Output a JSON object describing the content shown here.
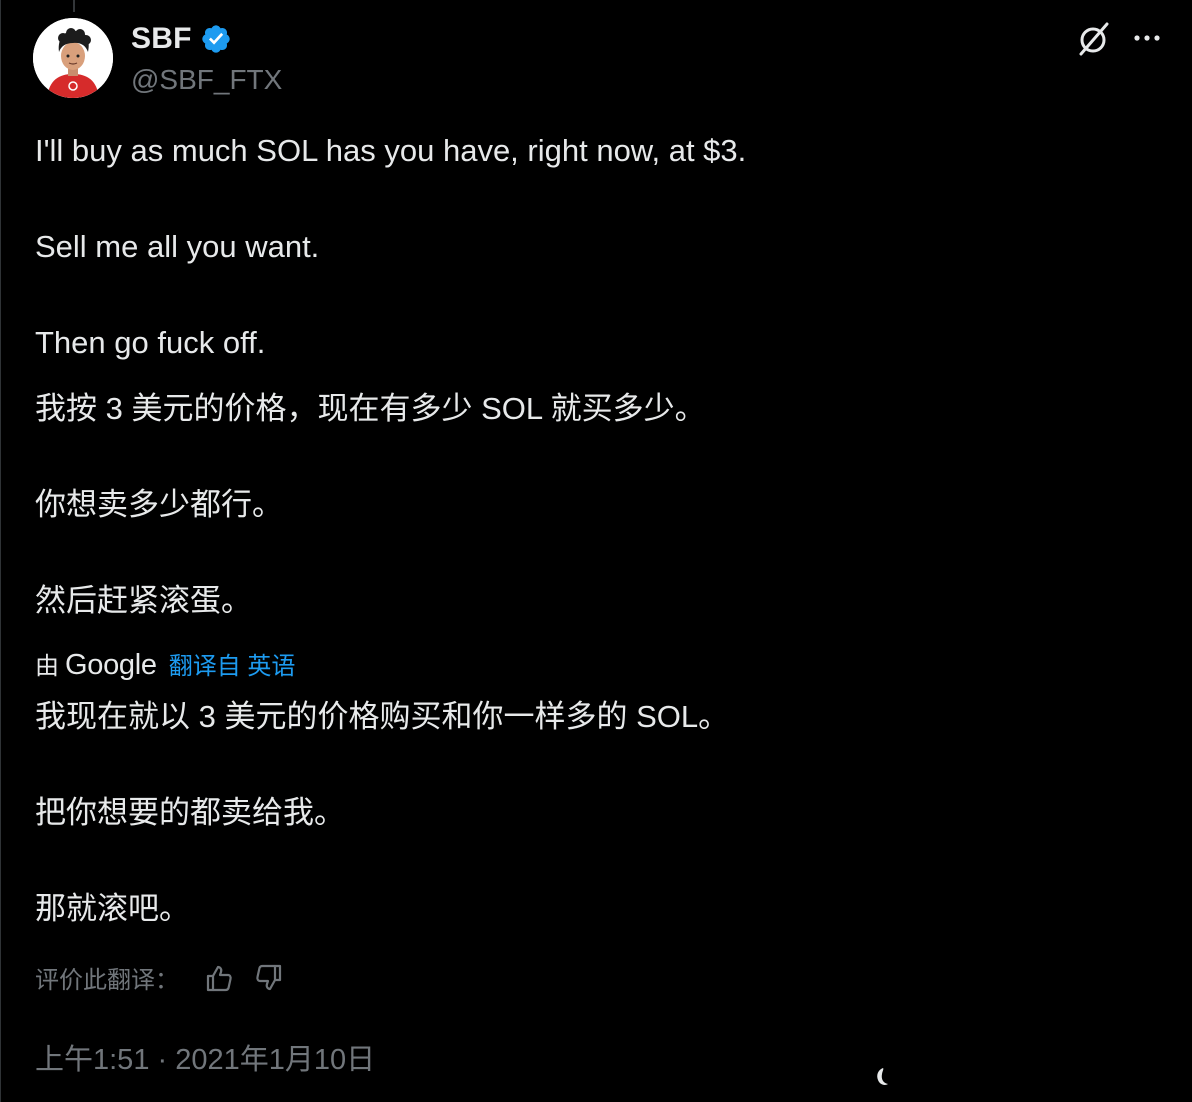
{
  "author": {
    "display_name": "SBF",
    "handle": "@SBF_FTX",
    "verified": true
  },
  "icons": {
    "verified": "verified-badge-icon",
    "grok": "grok-icon",
    "more": "more-options-icon",
    "thumbs_up": "thumbs-up-icon",
    "thumbs_down": "thumbs-down-icon"
  },
  "colors": {
    "background": "#000000",
    "text": "#e7e9ea",
    "muted": "#71767b",
    "link": "#1d9bf0",
    "verified": "#1d9bf0"
  },
  "tweet": {
    "original": [
      "I'll buy as much SOL has you have, right now, at $3.",
      "Sell me all you want.",
      "Then go fuck off."
    ],
    "display_translation": [
      "我按 3 美元的价格，现在有多少 SOL 就买多少。",
      "你想卖多少都行。",
      "然后赶紧滚蛋。"
    ],
    "translation_attribution": {
      "by": "由",
      "provider": "Google",
      "link_text": "翻译自 英语"
    },
    "google_translation": [
      "我现在就以 3 美元的价格购买和你一样多的 SOL。",
      "把你想要的都卖给我。",
      "那就滚吧。"
    ],
    "rate_label": "评价此翻译：",
    "timestamp": "上午1:51 · 2021年1月10日"
  }
}
